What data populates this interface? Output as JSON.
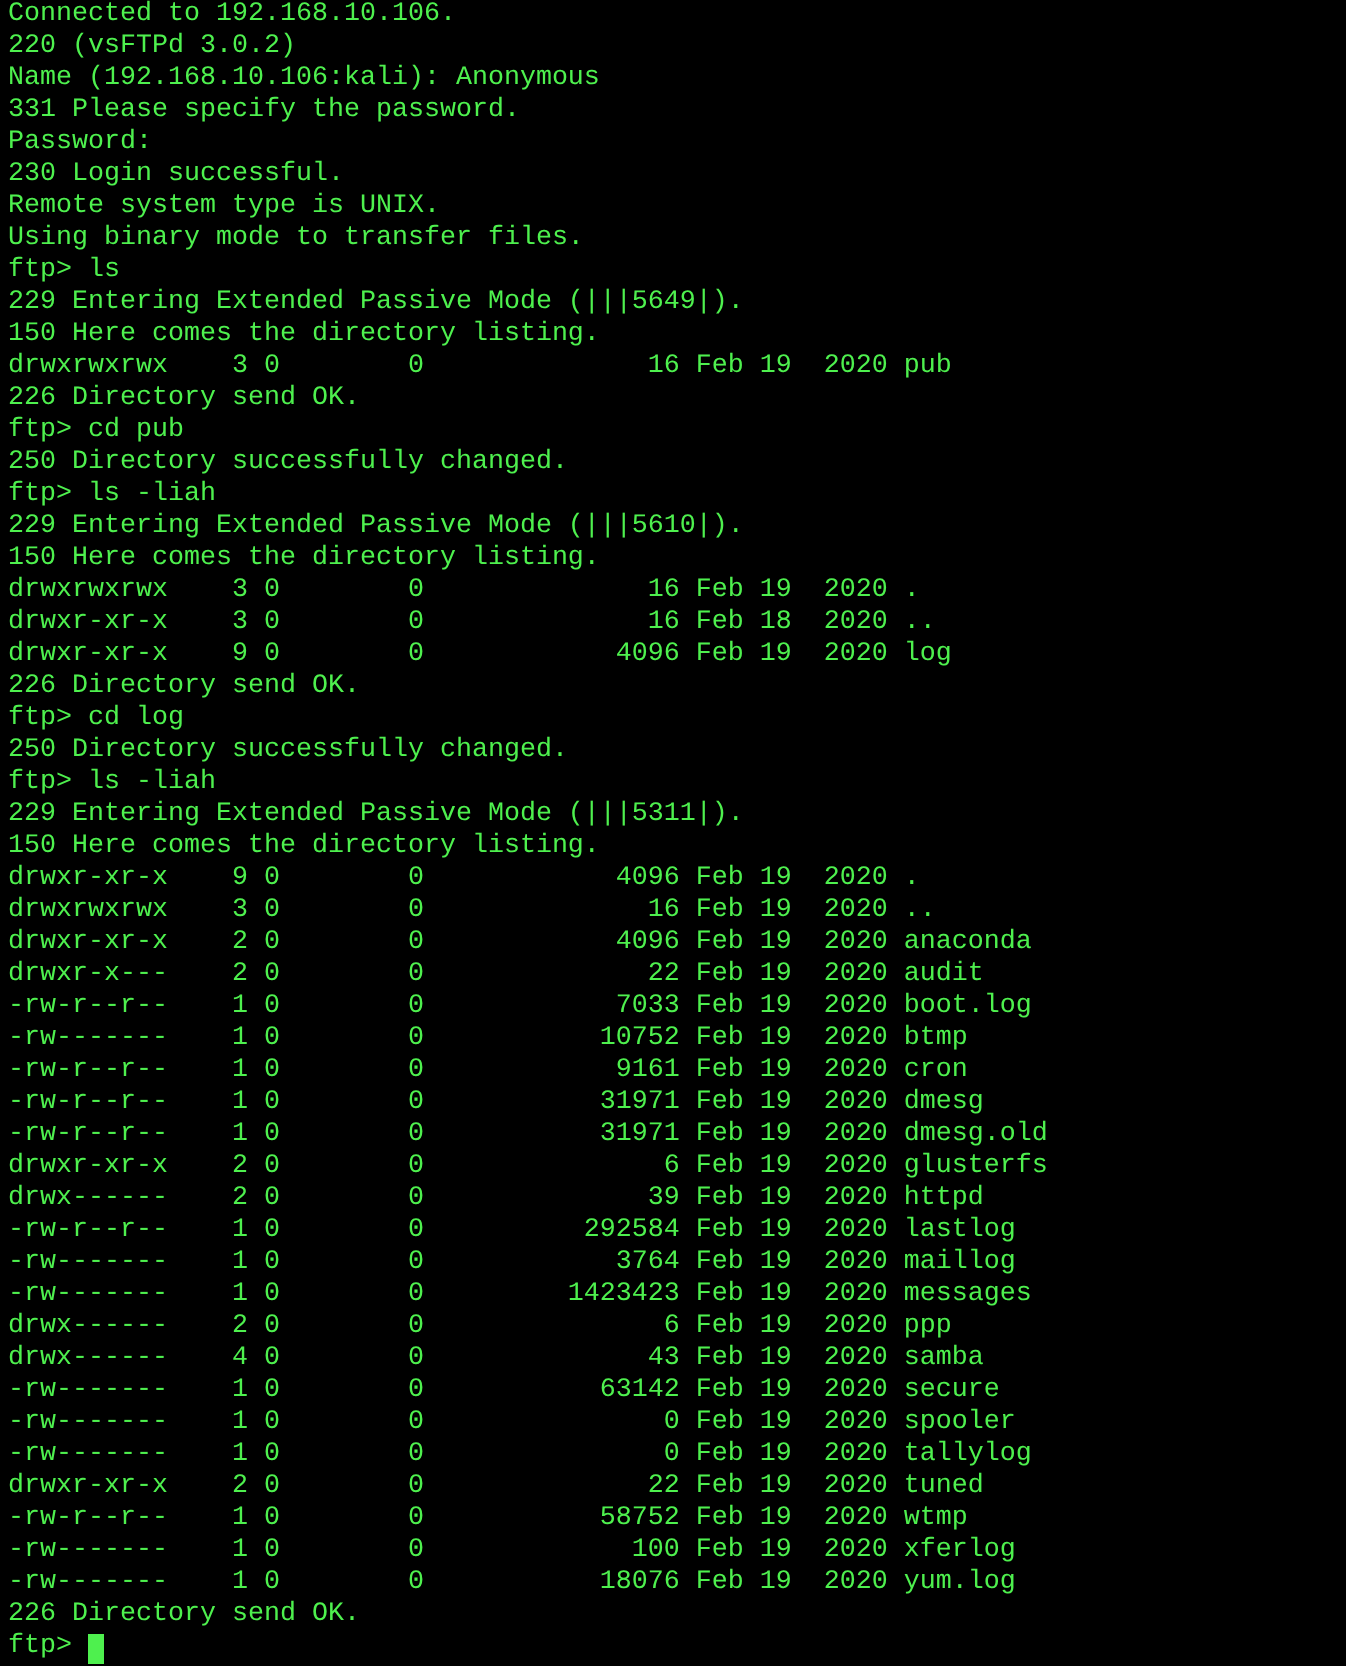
{
  "terminal": {
    "lines": [
      "Connected to 192.168.10.106.",
      "220 (vsFTPd 3.0.2)",
      "Name (192.168.10.106:kali): Anonymous",
      "331 Please specify the password.",
      "Password:",
      "230 Login successful.",
      "Remote system type is UNIX.",
      "Using binary mode to transfer files.",
      "ftp> ls",
      "229 Entering Extended Passive Mode (|||5649|).",
      "150 Here comes the directory listing.",
      "drwxrwxrwx    3 0        0              16 Feb 19  2020 pub",
      "226 Directory send OK.",
      "ftp> cd pub",
      "250 Directory successfully changed.",
      "ftp> ls -liah",
      "229 Entering Extended Passive Mode (|||5610|).",
      "150 Here comes the directory listing.",
      "drwxrwxrwx    3 0        0              16 Feb 19  2020 .",
      "drwxr-xr-x    3 0        0              16 Feb 18  2020 ..",
      "drwxr-xr-x    9 0        0            4096 Feb 19  2020 log",
      "226 Directory send OK.",
      "ftp> cd log",
      "250 Directory successfully changed.",
      "ftp> ls -liah",
      "229 Entering Extended Passive Mode (|||5311|).",
      "150 Here comes the directory listing.",
      "drwxr-xr-x    9 0        0            4096 Feb 19  2020 .",
      "drwxrwxrwx    3 0        0              16 Feb 19  2020 ..",
      "drwxr-xr-x    2 0        0            4096 Feb 19  2020 anaconda",
      "drwxr-x---    2 0        0              22 Feb 19  2020 audit",
      "-rw-r--r--    1 0        0            7033 Feb 19  2020 boot.log",
      "-rw-------    1 0        0           10752 Feb 19  2020 btmp",
      "-rw-r--r--    1 0        0            9161 Feb 19  2020 cron",
      "-rw-r--r--    1 0        0           31971 Feb 19  2020 dmesg",
      "-rw-r--r--    1 0        0           31971 Feb 19  2020 dmesg.old",
      "drwxr-xr-x    2 0        0               6 Feb 19  2020 glusterfs",
      "drwx------    2 0        0              39 Feb 19  2020 httpd",
      "-rw-r--r--    1 0        0          292584 Feb 19  2020 lastlog",
      "-rw-------    1 0        0            3764 Feb 19  2020 maillog",
      "-rw-------    1 0        0         1423423 Feb 19  2020 messages",
      "drwx------    2 0        0               6 Feb 19  2020 ppp",
      "drwx------    4 0        0              43 Feb 19  2020 samba",
      "-rw-------    1 0        0           63142 Feb 19  2020 secure",
      "-rw-------    1 0        0               0 Feb 19  2020 spooler",
      "-rw-------    1 0        0               0 Feb 19  2020 tallylog",
      "drwxr-xr-x    2 0        0              22 Feb 19  2020 tuned",
      "-rw-r--r--    1 0        0           58752 Feb 19  2020 wtmp",
      "-rw-------    1 0        0             100 Feb 19  2020 xferlog",
      "-rw-------    1 0        0           18076 Feb 19  2020 yum.log",
      "226 Directory send OK."
    ],
    "prompt": "ftp>"
  }
}
